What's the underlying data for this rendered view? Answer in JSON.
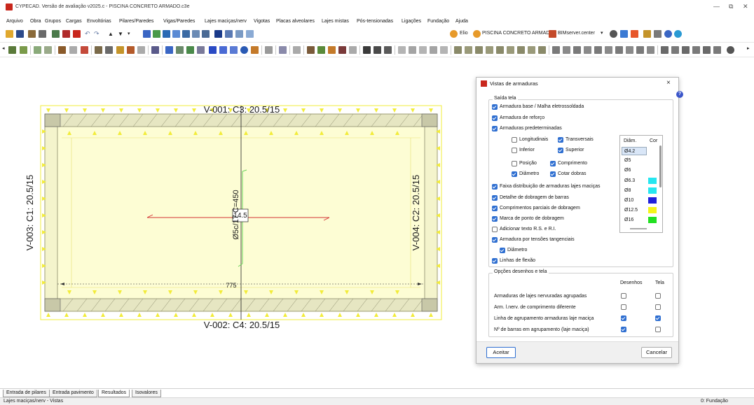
{
  "app": {
    "title": "CYPECAD. Versão de avaliação v2025.c - PISCINA CONCRETO ARMADO.c3e"
  },
  "menu": [
    "Arquivo",
    "Obra",
    "Grupos",
    "Cargas",
    "Envoltórias",
    "Pilares/Paredes",
    "Vigas/Paredes",
    "Lajes maciças/nerv",
    "Vigotas",
    "Placas alveolares",
    "Lajes mistas",
    "Pós-tensionadas",
    "Ligações",
    "Fundação",
    "Ajuda"
  ],
  "toolbar": {
    "user": "Elio",
    "project": "PISCINA CONCRETO ARMADO",
    "bim": "BIMserver.center"
  },
  "colors": {
    "slab_fill": "#fdfdd4",
    "slab_border": "#f2ec3a",
    "rebar_green": "#6bd25b",
    "rebar_red": "#d23333",
    "beam_label": "#1a1a1a",
    "checkbox_on": "#2f6fd1"
  },
  "drawing": {
    "beam_top": "V-001: C3: 20.5/15",
    "beam_bottom": "V-002: C4: 20.5/15",
    "beam_left": "V-003: C1: 20.5/15",
    "beam_right": "V-004: C2: 20.5/15",
    "rebar_label": "Ø5c/17 C=450",
    "rebar_marker": "14.5",
    "dimension": "775"
  },
  "dialog": {
    "title": "Vistas de armaduras",
    "close": "×",
    "help": "?",
    "section1_title": "Saída tela",
    "items": [
      {
        "label": "Armadura base / Malha eletrossoldada",
        "checked": true
      },
      {
        "label": "Armadura de reforço",
        "checked": true
      },
      {
        "label": "Armaduras predeterminadas",
        "checked": true
      }
    ],
    "sub_items": [
      {
        "label": "Longitudinais",
        "checked": false
      },
      {
        "label": "Transversais",
        "checked": true
      },
      {
        "label": "Inferior",
        "checked": false
      },
      {
        "label": "Superior",
        "checked": true
      },
      {
        "label": "Posição",
        "checked": false
      },
      {
        "label": "Comprimento",
        "checked": true
      },
      {
        "label": "Diâmetro",
        "checked": true
      },
      {
        "label": "Cotar dobras",
        "checked": true
      }
    ],
    "items2": [
      {
        "label": "Faixa distribuição de armaduras lajes maciças",
        "checked": true
      },
      {
        "label": "Detalhe de dobragem de barras",
        "checked": true
      },
      {
        "label": "Comprimentos parciais de dobragem",
        "checked": true
      },
      {
        "label": "Marca de ponto de dobragem",
        "checked": true
      },
      {
        "label": "Adicionar texto R.S. e R.I.",
        "checked": false
      },
      {
        "label": "Armadura por tensões tangenciais",
        "checked": true
      },
      {
        "label": "Diâmetro",
        "checked": true
      },
      {
        "label": "Linhas de flexão",
        "checked": true
      }
    ],
    "diam_table": {
      "col_diam": "Diâm.",
      "col_cor": "Cor",
      "rows": [
        {
          "d": "Ø4.2",
          "color": "#ffffff"
        },
        {
          "d": "Ø5",
          "color": "#ffffff"
        },
        {
          "d": "Ø6",
          "color": "#ffffff"
        },
        {
          "d": "Ø6.3",
          "color": "#26e6f0"
        },
        {
          "d": "Ø8",
          "color": "#26e6f0"
        },
        {
          "d": "Ø10",
          "color": "#1f1fdc"
        },
        {
          "d": "Ø12.5",
          "color": "#f4f41a"
        },
        {
          "d": "Ø16",
          "color": "#22e022"
        }
      ]
    },
    "section2_title": "Opções desenhos e tela",
    "col_desenhos": "Desenhos",
    "col_tela": "Tela",
    "options": [
      {
        "label": "Armaduras de lajes nervuradas agrupadas",
        "desenhos": false,
        "tela": false
      },
      {
        "label": "Arm. l.nerv. de comprimento diferente",
        "desenhos": false,
        "tela": false
      },
      {
        "label": "Linha de agrupamento armaduras laje maciça",
        "desenhos": true,
        "tela": true
      },
      {
        "label": "Nº de barras em agrupamento (laje maciça)",
        "desenhos": true,
        "tela": false
      }
    ],
    "ok": "Aceitar",
    "cancel": "Cancelar"
  },
  "tabs": [
    "Entrada de pilares",
    "Entrada pavimento",
    "Resultados",
    "Isovalores"
  ],
  "active_tab": "Resultados",
  "status": {
    "left": "Lajes maciças/nerv - Vistas",
    "right": "0: Fundação"
  }
}
